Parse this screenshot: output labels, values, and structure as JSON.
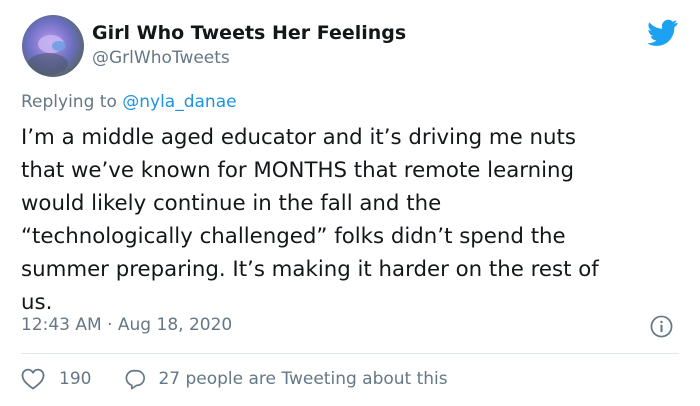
{
  "author": {
    "display_name": "Girl Who Tweets Her Feelings",
    "handle": "@GrlWhoTweets"
  },
  "reply": {
    "prefix": "Replying to",
    "mention": "@nyla_danae"
  },
  "tweet": {
    "lines": [
      "I’m a middle aged educator and it’s driving me nuts",
      "that we’ve known for MONTHS that remote learning",
      "would likely continue in the fall and the",
      "“technologically challenged” folks didn’t spend the",
      "summer preparing. It’s making it harder on the rest of",
      "us."
    ],
    "timestamp": "12:43 AM · Aug 18, 2020"
  },
  "actions": {
    "like_count": "190",
    "conversation_text": "27 people are Tweeting about this"
  },
  "icons": {
    "brand": "twitter-bird-icon",
    "info": "info-icon",
    "like": "heart-icon",
    "reply": "speech-bubble-icon"
  },
  "colors": {
    "brand_blue": "#1da1f2",
    "link_blue": "#1b95e0",
    "secondary_text": "#657786",
    "primary_text": "#14171a",
    "divider": "#e1e8ed"
  }
}
